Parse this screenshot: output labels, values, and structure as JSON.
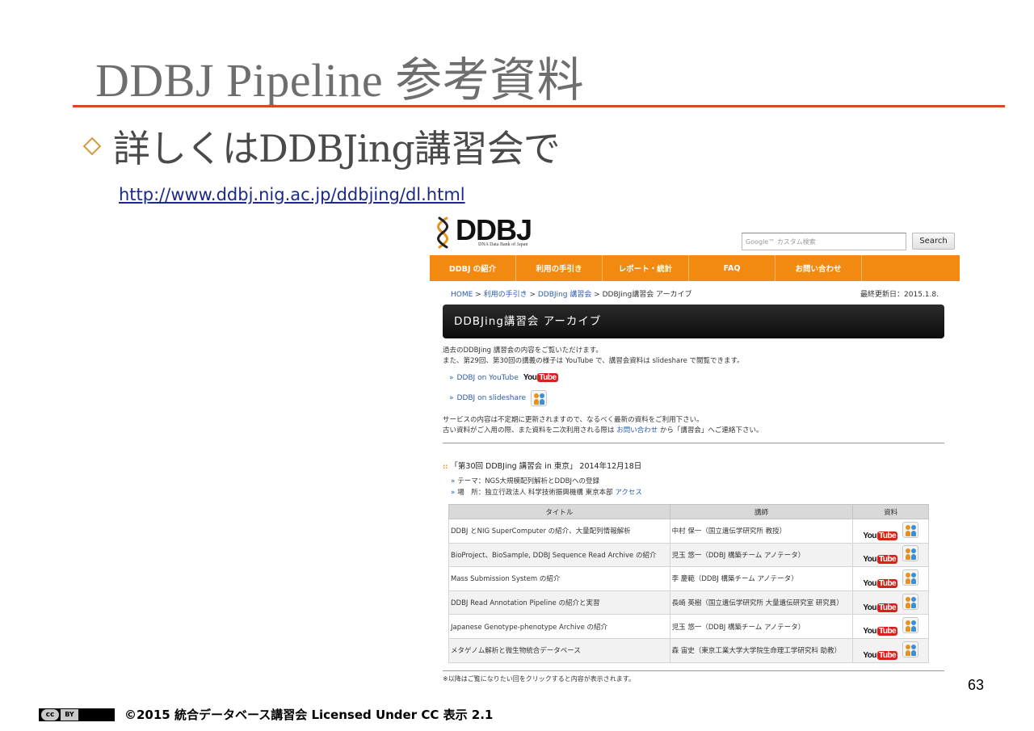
{
  "slide": {
    "title": "DDBJ Pipeline 参考資料",
    "bullet": "詳しくはDDBJing講習会で",
    "link": "http://www.ddbj.nig.ac.jp/ddbjing/dl.html",
    "page_number": "63",
    "footer": "©2015 統合データベース講習会 Licensed Under CC 表示 2.1",
    "cc_badge": {
      "cc": "cc",
      "by": "BY"
    },
    "colors": {
      "title_rule": "#d8462f",
      "bullet_diamond": "#d49a3c"
    }
  },
  "website": {
    "logo": {
      "name": "DDBJ",
      "subtitle": "DNA Data Bank of Japan"
    },
    "search": {
      "placeholder": "Google™ カスタム検索",
      "button": "Search"
    },
    "nav": [
      "DDBJ の紹介",
      "利用の手引き",
      "レポート・統計",
      "FAQ",
      "お問い合わせ"
    ],
    "breadcrumb": {
      "home": "HOME",
      "sep": " > ",
      "item1": "利用の手引き",
      "item2": "DDBJing 講習会",
      "current": "DDBJing講習会 アーカイブ"
    },
    "last_updated": "最終更新日：2015.1.8.",
    "page_heading": "DDBJing講習会 アーカイブ",
    "intro": [
      "過去のDDBJing 講習会の内容をご覧いただけます。",
      "また、第29回、第30回の講義の様子は YouTube で、講習会資料は slideshare で閲覧できます。"
    ],
    "resource_links": {
      "raquo": "»",
      "youtube_label": "DDBJ on YouTube",
      "slideshare_label": "DDBJ on slideshare"
    },
    "youtube_logo": {
      "you": "You",
      "tube": "Tube"
    },
    "notice": {
      "line1": "サービスの内容は不定期に更新されますので、なるべく最新の資料をご利用下さい。",
      "line2_pre": "古い資料がご入用の際、また資料を二次利用される際は ",
      "line2_link": "お問い合わせ",
      "line2_post": " から「講習会」へご連絡下さい。"
    },
    "session": {
      "mark": "::",
      "title": "「第30回 DDBJing 講習会 in 東京」 2014年12月18日",
      "theme": "テーマ：NGS大規模配列解析とDDBJへの登録",
      "venue_pre": "場　所：独立行政法人 科学技術振興機構 東京本部 ",
      "venue_link": "アクセス"
    },
    "table": {
      "headers": [
        "タイトル",
        "講師",
        "資料"
      ],
      "rows": [
        {
          "title": "DDBJ とNIG SuperComputer の紹介、大量配列情報解析",
          "lecturer": "中村 保一（国立遺伝学研究所 教授）"
        },
        {
          "title": "BioProject、BioSample, DDBJ Sequence Read Archive の紹介",
          "lecturer": "児玉 悠一（DDBJ 構築チーム アノテータ）"
        },
        {
          "title": "Mass Submission System の紹介",
          "lecturer": "李 慶範（DDBJ 構築チーム アノテータ）"
        },
        {
          "title": "DDBJ Read Annotation Pipeline の紹介と実習",
          "lecturer": "長崎 英樹（国立遺伝学研究所 大量遺伝研究室 研究員）"
        },
        {
          "title": "Japanese Genotype-phenotype Archive の紹介",
          "lecturer": "児玉 悠一（DDBJ 構築チーム アノテータ）"
        },
        {
          "title": "メタゲノム解析と微生物統合データベース",
          "lecturer": "森 宙史（東京工業大学大学院生命理工学研究科 助教）"
        }
      ]
    },
    "footnote": "※以降はご覧になりたい回をクリックすると内容が表示されます。",
    "colors": {
      "nav": "#f28a12",
      "link": "#2b5ca8",
      "youtube_red": "#d9211b"
    }
  }
}
